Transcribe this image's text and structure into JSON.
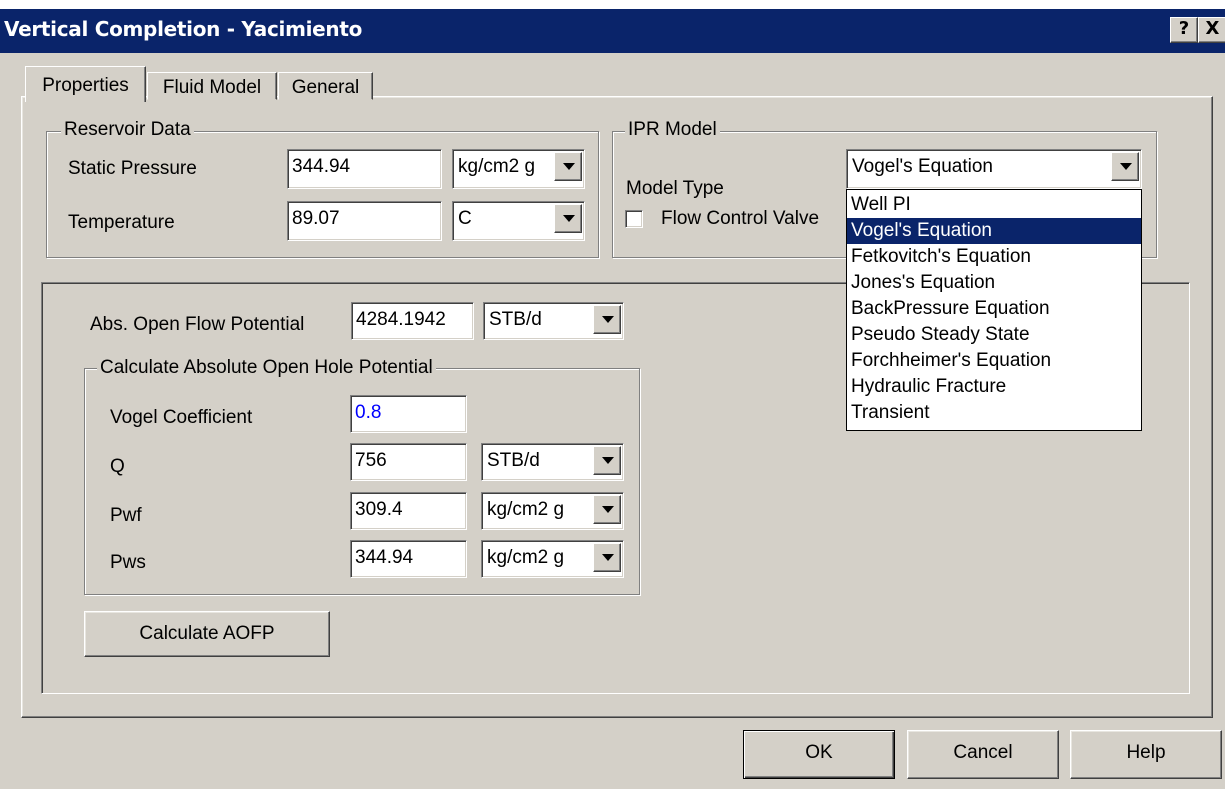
{
  "window": {
    "title": "Vertical Completion - Yacimiento",
    "help_button": "?",
    "close_button": "X"
  },
  "tabs": [
    {
      "label": "Properties"
    },
    {
      "label": "Fluid Model"
    },
    {
      "label": "General"
    }
  ],
  "reservoir": {
    "legend": "Reservoir Data",
    "static_pressure_label": "Static Pressure",
    "static_pressure_value": "344.94",
    "static_pressure_unit": "kg/cm2 g",
    "temperature_label": "Temperature",
    "temperature_value": "89.07",
    "temperature_unit": "C"
  },
  "ipr": {
    "legend": "IPR Model",
    "model_type_label": "Model Type",
    "model_type_value": "Vogel's Equation",
    "flow_control_label": "Flow Control Valve",
    "flow_control_checked": false,
    "options": [
      "Well PI",
      "Vogel's Equation",
      "Fetkovitch's Equation",
      "Jones's Equation",
      "BackPressure Equation",
      "Pseudo Steady State",
      "Forchheimer's Equation",
      "Hydraulic Fracture",
      "Transient"
    ],
    "selected_index": 1
  },
  "aofp": {
    "label": "Abs. Open Flow Potential",
    "value": "4284.1942",
    "unit": "STB/d"
  },
  "calc": {
    "legend": "Calculate Absolute Open Hole Potential",
    "vogel_label": "Vogel Coefficient",
    "vogel_value": "0.8",
    "q_label": "Q",
    "q_value": "756",
    "q_unit": "STB/d",
    "pwf_label": "Pwf",
    "pwf_value": "309.4",
    "pwf_unit": "kg/cm2 g",
    "pws_label": "Pws",
    "pws_value": "344.94",
    "pws_unit": "kg/cm2 g",
    "button": "Calculate AOFP"
  },
  "buttons": {
    "ok": "OK",
    "cancel": "Cancel",
    "help": "Help"
  },
  "colors": {
    "titlebar": "#0a246a",
    "face": "#d4d0c8",
    "highlight_value": "#0000ff"
  }
}
